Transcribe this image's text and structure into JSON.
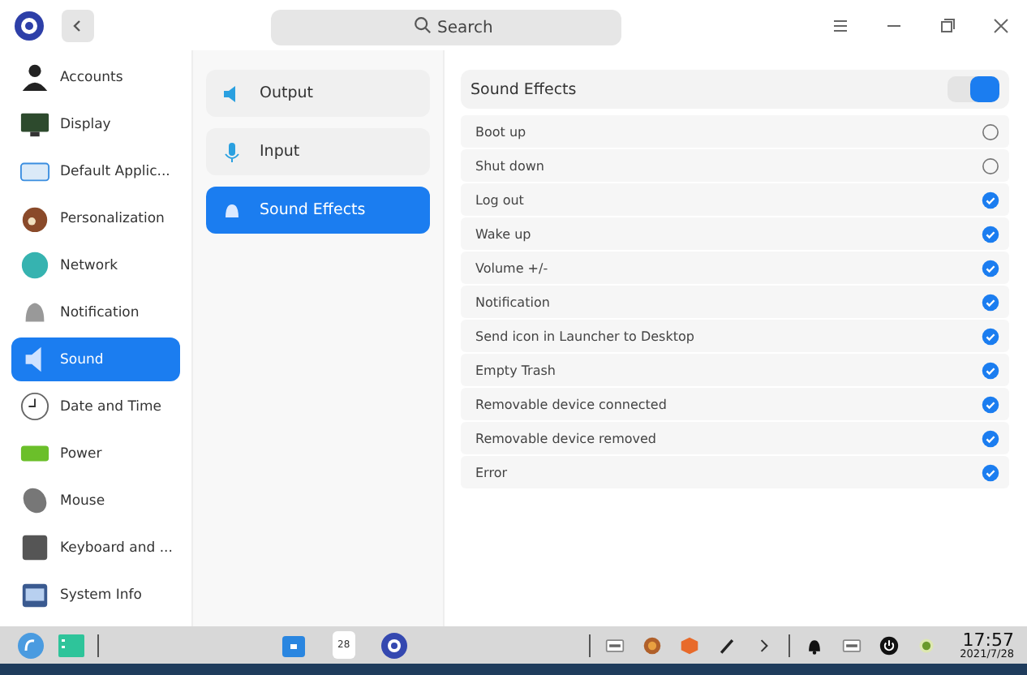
{
  "search": {
    "placeholder": "Search"
  },
  "sidebar": {
    "items": [
      {
        "label": "Accounts",
        "selected": false
      },
      {
        "label": "Display",
        "selected": false
      },
      {
        "label": "Default Applic...",
        "selected": false
      },
      {
        "label": "Personalization",
        "selected": false
      },
      {
        "label": "Network",
        "selected": false
      },
      {
        "label": "Notification",
        "selected": false
      },
      {
        "label": "Sound",
        "selected": true
      },
      {
        "label": "Date and Time",
        "selected": false
      },
      {
        "label": "Power",
        "selected": false
      },
      {
        "label": "Mouse",
        "selected": false
      },
      {
        "label": "Keyboard and ...",
        "selected": false
      },
      {
        "label": "System Info",
        "selected": false
      }
    ]
  },
  "subnav": {
    "items": [
      {
        "label": "Output",
        "selected": false
      },
      {
        "label": "Input",
        "selected": false
      },
      {
        "label": "Sound Effects",
        "selected": true
      }
    ]
  },
  "sound_effects": {
    "title": "Sound Effects",
    "on": true,
    "items": [
      {
        "label": "Boot up",
        "checked": false
      },
      {
        "label": "Shut down",
        "checked": false
      },
      {
        "label": "Log out",
        "checked": true
      },
      {
        "label": "Wake up",
        "checked": true
      },
      {
        "label": "Volume +/-",
        "checked": true
      },
      {
        "label": "Notification",
        "checked": true
      },
      {
        "label": "Send icon in Launcher to Desktop",
        "checked": true
      },
      {
        "label": "Empty Trash",
        "checked": true
      },
      {
        "label": "Removable device connected",
        "checked": true
      },
      {
        "label": "Removable device removed",
        "checked": true
      },
      {
        "label": "Error",
        "checked": true
      }
    ]
  },
  "taskbar": {
    "calendar_day": "28",
    "time": "17:57",
    "date": "2021/7/28"
  }
}
